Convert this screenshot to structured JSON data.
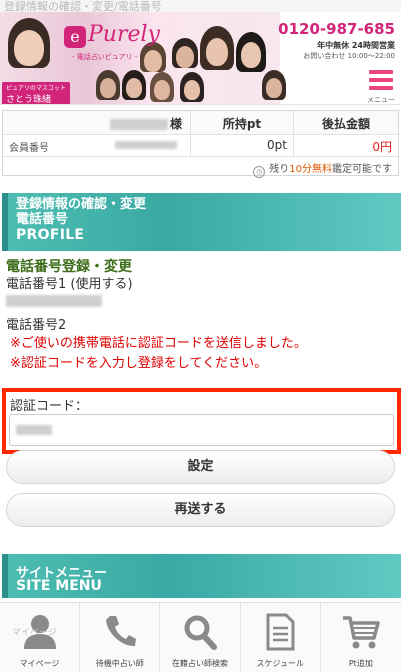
{
  "browser": {
    "title": "登録情報の確認・変更/電話番号"
  },
  "header": {
    "logo_text": "Purely",
    "logo_sub": "- 電話占いピュアリ -",
    "tagline": "ピュアリのマスコット",
    "mascot_name": "さとう珠緒",
    "phone": "0120-987-685",
    "hours": "年中無休 24時間営業",
    "contact_hours": "お問い合わせ 10:00～22:00",
    "menu_label": "メニュー"
  },
  "account": {
    "name_suffix": "様",
    "points_header": "所持pt",
    "unpaid_header": "後払金額",
    "member_label": "会員番号",
    "points_value": "0pt",
    "unpaid_value": "0円",
    "free_note_prefix": "残り",
    "free_note_highlight": "10分無料",
    "free_note_suffix": "鑑定可能です"
  },
  "profile_section": {
    "title_line1": "登録情報の確認・変更",
    "title_line2": "電話番号",
    "title_en": "PROFILE"
  },
  "content": {
    "sub_title": "電話番号登録・変更",
    "phone1_label": "電話番号1 (使用する)",
    "phone2_label": "電話番号2",
    "notice1": "※ご使いの携帯電話に認証コードを送信しました。",
    "notice2": "※認証コードを入力し登録をしてください。"
  },
  "verification": {
    "label": "認証コード："
  },
  "buttons": {
    "submit": "設定",
    "resend": "再送する"
  },
  "site_menu": {
    "title": "サイトメニュー",
    "title_en": "SITE MENU"
  },
  "tabbar": {
    "items": [
      {
        "label": "マイページ",
        "icon": "person-icon",
        "ghost": "マイページ"
      },
      {
        "label": "待機中占い師",
        "icon": "phone-icon"
      },
      {
        "label": "在籍占い師検索",
        "icon": "search-icon"
      },
      {
        "label": "スケジュール",
        "icon": "document-icon"
      },
      {
        "label": "Pt追加",
        "icon": "cart-icon"
      }
    ]
  }
}
